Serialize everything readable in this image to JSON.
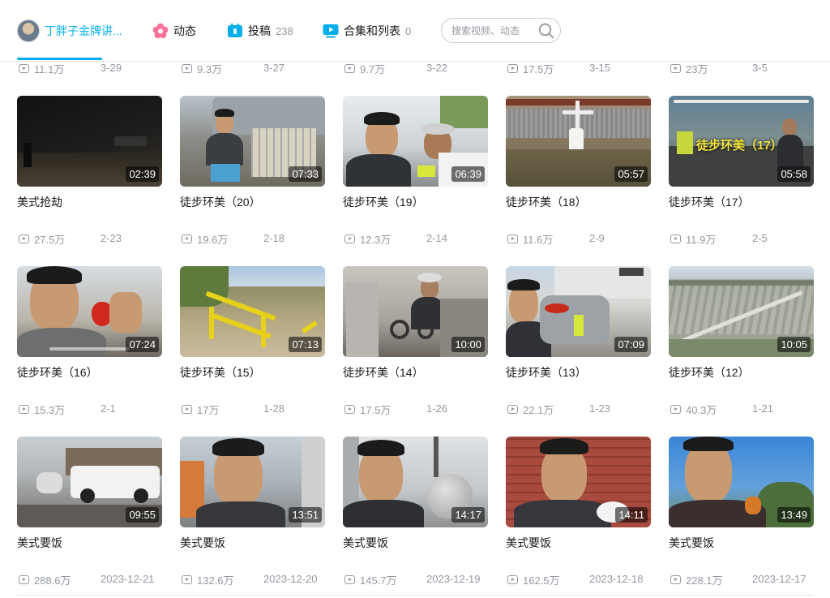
{
  "header": {
    "user_name": "丁胖子金牌讲...",
    "nav": [
      {
        "label": "动态",
        "count": ""
      },
      {
        "label": "投稿",
        "count": "238"
      },
      {
        "label": "合集和列表",
        "count": "0"
      }
    ],
    "search_placeholder": "搜索视频、动态"
  },
  "top_stats": [
    {
      "views": "11.1万",
      "date": "3-29"
    },
    {
      "views": "9.3万",
      "date": "3-27"
    },
    {
      "views": "9.7万",
      "date": "3-22"
    },
    {
      "views": "17.5万",
      "date": "3-15"
    },
    {
      "views": "23万",
      "date": "3-5"
    }
  ],
  "rows": [
    [
      {
        "title": "美式抢劫",
        "duration": "02:39",
        "views": "27.5万",
        "date": "2-23"
      },
      {
        "title": "徒步环美（20）",
        "duration": "07:33",
        "views": "19.6万",
        "date": "2-18"
      },
      {
        "title": "徒步环美（19）",
        "duration": "06:39",
        "views": "12.3万",
        "date": "2-14"
      },
      {
        "title": "徒步环美（18）",
        "duration": "05:57",
        "views": "11.6万",
        "date": "2-9"
      },
      {
        "title": "徒步环美（17）",
        "duration": "05:58",
        "views": "11.9万",
        "date": "2-5"
      }
    ],
    [
      {
        "title": "徒步环美（16）",
        "duration": "07:24",
        "views": "15.3万",
        "date": "2-1"
      },
      {
        "title": "徒步环美（15）",
        "duration": "07:13",
        "views": "17万",
        "date": "1-28"
      },
      {
        "title": "徒步环美（14）",
        "duration": "10:00",
        "views": "17.5万",
        "date": "1-26"
      },
      {
        "title": "徒步环美（13）",
        "duration": "07:09",
        "views": "22.1万",
        "date": "1-23"
      },
      {
        "title": "徒步环美（12）",
        "duration": "10:05",
        "views": "40.3万",
        "date": "1-21"
      }
    ],
    [
      {
        "title": "美式要饭",
        "duration": "09:55",
        "views": "288.6万",
        "date": "2023-12-21"
      },
      {
        "title": "美式要饭",
        "duration": "13:51",
        "views": "132.6万",
        "date": "2023-12-20"
      },
      {
        "title": "美式要饭",
        "duration": "14:17",
        "views": "145.7万",
        "date": "2023-12-19"
      },
      {
        "title": "美式要饭",
        "duration": "14:11",
        "views": "162.5万",
        "date": "2023-12-18"
      },
      {
        "title": "美式要饭",
        "duration": "13:49",
        "views": "228.1万",
        "date": "2023-12-17"
      }
    ]
  ],
  "thumb_overlay_text": "徒步环美（17）",
  "colors": {
    "accent": "#00aeec",
    "pink_icon": "#fb7299",
    "meta": "#9499a0"
  }
}
